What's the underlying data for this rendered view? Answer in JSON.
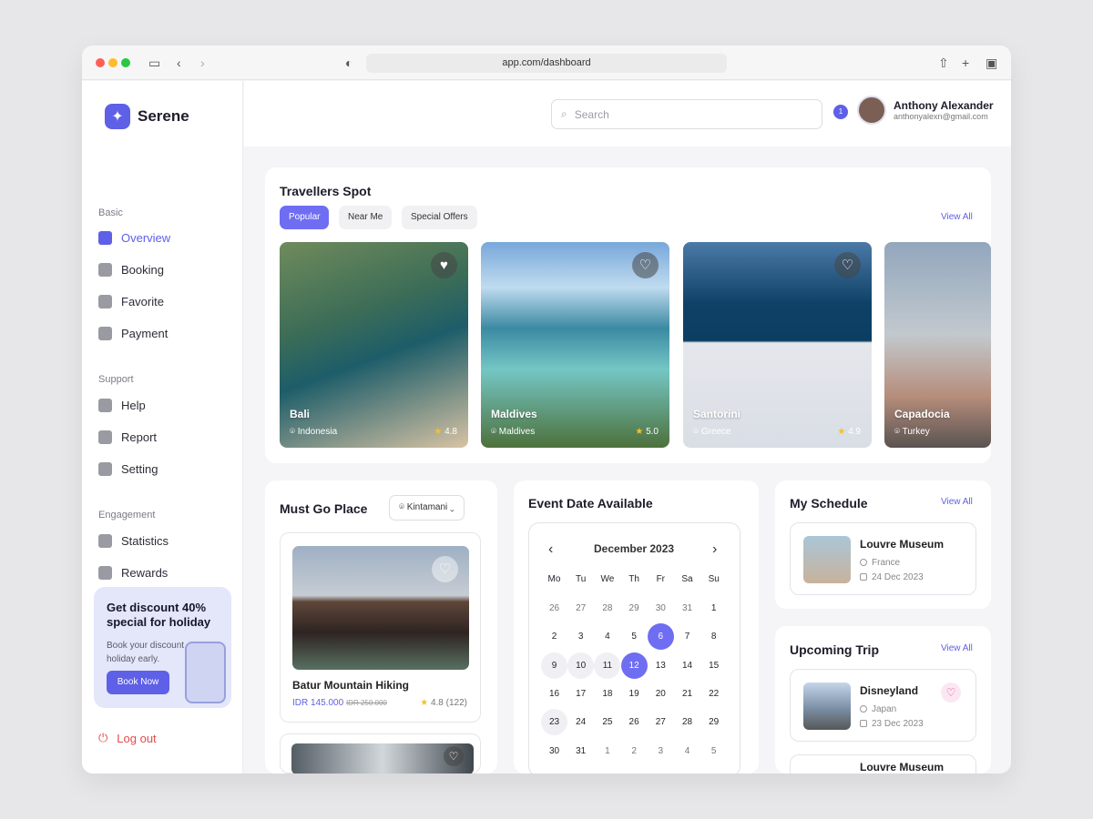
{
  "window": {
    "url": "app.com/dashboard"
  },
  "sidebar": {
    "brand": "Serene",
    "sections": {
      "basic": "Basic",
      "support": "Support",
      "engagement": "Engagement"
    },
    "items": {
      "overview": "Overview",
      "booking": "Booking",
      "favorite": "Favorite",
      "payment": "Payment",
      "help": "Help",
      "report": "Report",
      "setting": "Setting",
      "statistics": "Statistics",
      "rewards": "Rewards"
    },
    "promo": {
      "title": "Get discount 40% special for holiday",
      "text": "Book your discount holiday early.",
      "button": "Book Now"
    },
    "logout": "Log out"
  },
  "header": {
    "search_placeholder": "Search",
    "notification_count": "1",
    "user_name": "Anthony Alexander",
    "user_email": "anthonyalexn@gmail.com"
  },
  "travellers": {
    "title": "Travellers Spot",
    "view_all": "View All",
    "tabs": [
      "Popular",
      "Near Me",
      "Special Offers"
    ],
    "spots": [
      {
        "name": "Bali",
        "location": "Indonesia",
        "rating": "4.8"
      },
      {
        "name": "Maldives",
        "location": "Maldives",
        "rating": "5.0"
      },
      {
        "name": "Santorini",
        "location": "Greece",
        "rating": "4.9"
      },
      {
        "name": "Capadocia",
        "location": "Turkey",
        "rating": ""
      }
    ]
  },
  "must_go": {
    "title": "Must Go Place",
    "location_select": "Kintamani",
    "place": {
      "name": "Batur Mountain Hiking",
      "price": "IDR 145.000",
      "old_price": "IDR 250.000",
      "rating": "4.8 (122)"
    }
  },
  "event": {
    "title": "Event Date Available",
    "month": "December 2023",
    "weekdays": [
      "Mo",
      "Tu",
      "We",
      "Th",
      "Fr",
      "Sa",
      "Su"
    ],
    "days": [
      "26",
      "27",
      "28",
      "29",
      "30",
      "31",
      "1",
      "2",
      "3",
      "4",
      "5",
      "6",
      "7",
      "8",
      "9",
      "10",
      "11",
      "12",
      "13",
      "14",
      "15",
      "16",
      "17",
      "18",
      "19",
      "20",
      "21",
      "22",
      "23",
      "24",
      "25",
      "26",
      "27",
      "28",
      "29",
      "30",
      "31",
      "1",
      "2",
      "3",
      "4",
      "5"
    ]
  },
  "schedule": {
    "title": "My Schedule",
    "view_all": "View All",
    "item": {
      "name": "Louvre Museum",
      "country": "France",
      "date": "24 Dec 2023"
    }
  },
  "upcoming": {
    "title": "Upcoming Trip",
    "view_all": "View All",
    "item": {
      "name": "Disneyland",
      "country": "Japan",
      "date": "23 Dec 2023"
    },
    "next_item": "Louvre Museum"
  }
}
